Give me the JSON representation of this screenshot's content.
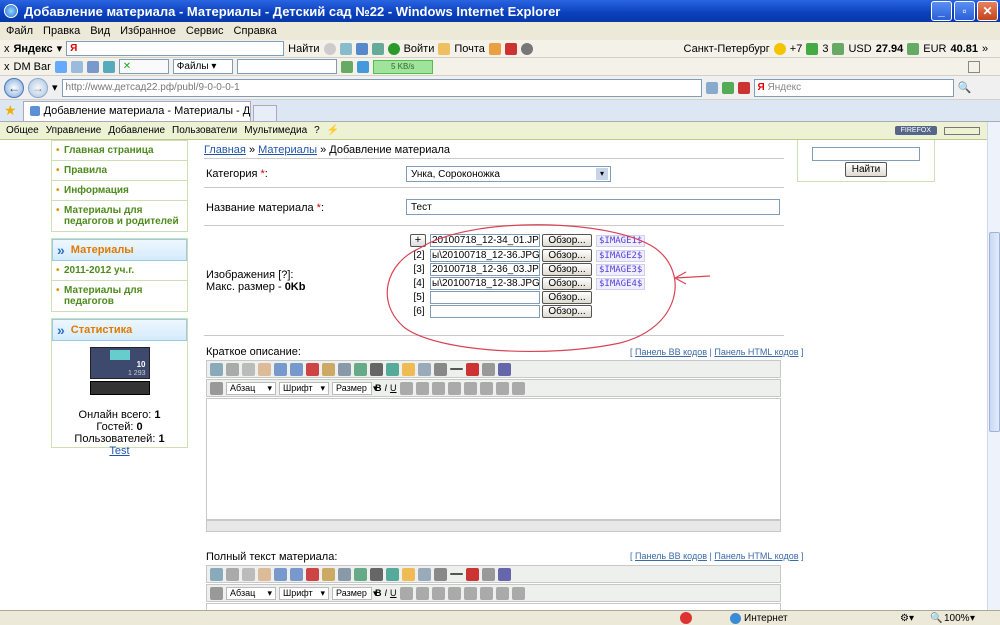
{
  "window": {
    "title": "Добавление материала - Материалы - Детский сад №22 - Windows Internet Explorer"
  },
  "menu": [
    "Файл",
    "Правка",
    "Вид",
    "Избранное",
    "Сервис",
    "Справка"
  ],
  "yandex_bar": {
    "close": "x",
    "brand": "Яндекс",
    "find": "Найти",
    "enter": "Войти",
    "mail": "Почта",
    "city": "Санкт-Петербург",
    "temp": "+7",
    "score": "3",
    "usd_label": "USD",
    "usd": "27.94",
    "eur_label": "EUR",
    "eur": "40.81"
  },
  "dm_bar": {
    "close": "x",
    "label": "DM Bar",
    "files": "Файлы",
    "speed": "5 KB/s"
  },
  "address": {
    "url": "http://www.детсад22.рф/publ/9-0-0-0-1",
    "search_placeholder": "Яндекс"
  },
  "tab": {
    "label": "Добавление материала - Материалы - Дет..."
  },
  "ucoz_bar": {
    "items": [
      "Общее",
      "Управление",
      "Добавление",
      "Пользователи",
      "Мультимедиа",
      "?"
    ],
    "badge": "FIREFOX"
  },
  "sidebar": {
    "menu_items": [
      "Главная страница",
      "Правила",
      "Информация",
      "Материалы для педагогов и родителей"
    ],
    "materials": {
      "title": "Материалы",
      "items": [
        "2011-2012 уч.г.",
        "Материалы для педагогов"
      ]
    },
    "stats": {
      "title": "Статистика",
      "counter_value": "10",
      "counter_total": "1 293",
      "online_total_label": "Онлайн всего:",
      "online_total": "1",
      "guests_label": "Гостей:",
      "guests": "0",
      "users_label": "Пользователей:",
      "users": "1",
      "user_link": "Test"
    }
  },
  "search_box": {
    "button": "Найти"
  },
  "breadcrumb": {
    "home": "Главная",
    "sep": "»",
    "section": "Материалы",
    "current": "Добавление материала"
  },
  "form": {
    "category_label": "Категория",
    "required": "*",
    "colon": ":",
    "category_value": "Унка, Сороконожка",
    "name_label": "Название материала",
    "name_value": "Тест",
    "images_label": "Изображения [?]:",
    "max_size_label": "Макс. размер -",
    "max_size_value": "0Kb",
    "browse": "Обзор...",
    "files": [
      {
        "idx": "+",
        "value": "20100718_12-34_01.JPG",
        "code": "$IMAGE1$"
      },
      {
        "idx": "[2]",
        "value": "ы\\20100718_12-36.JPG",
        "code": "$IMAGE2$"
      },
      {
        "idx": "[3]",
        "value": "20100718_12-36_03.JPG",
        "code": "$IMAGE3$"
      },
      {
        "idx": "[4]",
        "value": "ы\\20100718_12-38.JPG",
        "code": "$IMAGE4$"
      },
      {
        "idx": "[5]",
        "value": "",
        "code": ""
      },
      {
        "idx": "[6]",
        "value": "",
        "code": ""
      }
    ],
    "short_desc_label": "Краткое описание:",
    "full_text_label": "Полный текст материала:",
    "panel_bb": "Панель BB кодов",
    "panel_html": "Панель HTML кодов",
    "editor": {
      "paragraph": "Абзац",
      "font": "Шрифт",
      "size": "Размер"
    }
  },
  "status": {
    "zone": "Интернет",
    "zoom": "100%"
  }
}
